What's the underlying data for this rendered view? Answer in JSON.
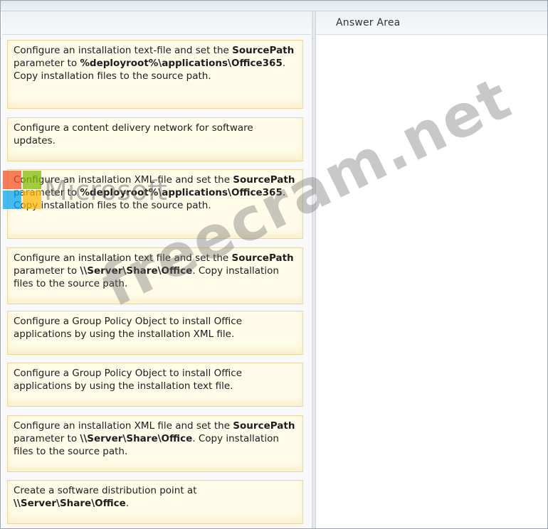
{
  "answer_area": {
    "title": "Answer Area"
  },
  "cards": [
    {
      "text1": "Configure an installation text-file and set the ",
      "b1": "SourcePath",
      "text2": " parameter to ",
      "b2": "%deployroot%\\applications\\Office365",
      "text3": ". Copy installation files to the source path."
    },
    {
      "text1": "Configure a content delivery network for software updates.",
      "b1": "",
      "text2": "",
      "b2": "",
      "text3": ""
    },
    {
      "text1": "Configure an installation XML file and set the ",
      "b1": "SourcePath",
      "text2": " parameter to ",
      "b2": "%deployroot%\\applications\\Office365",
      "text3": ". Copy installation files to the source path."
    },
    {
      "text1": "Configure an installation text file and set the ",
      "b1": "SourcePath",
      "text2": " parameter to ",
      "b2": "\\\\Server\\Share\\Office",
      "text3": ". Copy installation files to the source path."
    },
    {
      "text1": "Configure a Group Policy Object to install Office applications by using the installation XML file.",
      "b1": "",
      "text2": "",
      "b2": "",
      "text3": ""
    },
    {
      "text1": "Configure a Group Policy Object to install Office applications by using the installation text file.",
      "b1": "",
      "text2": "",
      "b2": "",
      "text3": ""
    },
    {
      "text1": "Configure an installation XML file and set the ",
      "b1": "SourcePath",
      "text2": " parameter to ",
      "b2": "\\\\Server\\Share\\Office",
      "text3": ". Copy installation files to the source path."
    },
    {
      "text1": "Create a software distribution point at ",
      "b1": "\\\\Server\\Share\\Office",
      "text2": ".",
      "b2": "",
      "text3": ""
    }
  ],
  "watermark": {
    "brand": "Microsoft",
    "site": "freecram.net"
  },
  "colors": {
    "card_bg": "#fffcea",
    "card_border": "#e7d79c"
  }
}
